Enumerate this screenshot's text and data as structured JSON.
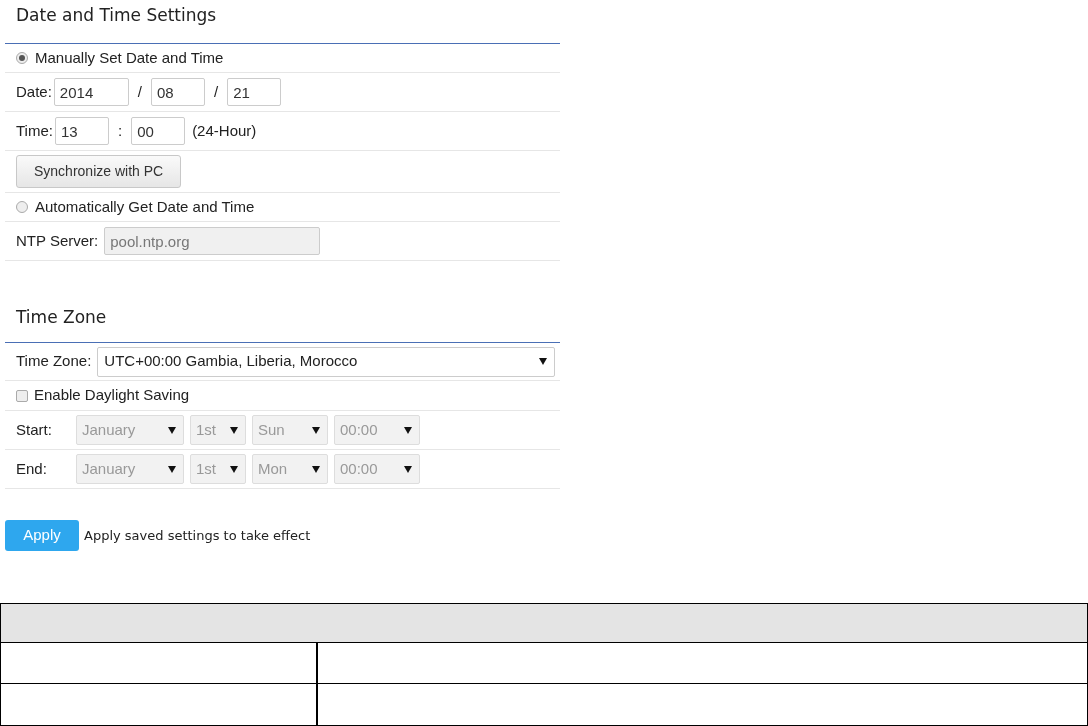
{
  "sections": [
    {
      "title": "Date and Time Settings",
      "rows": [
        {
          "kind": "radio",
          "label": "Manually Set Date and Time",
          "selected": true
        },
        {
          "kind": "fields",
          "label": "Date:",
          "items": [
            {
              "kind": "input",
              "value": "2014"
            },
            {
              "kind": "sep",
              "text": "/"
            },
            {
              "kind": "input",
              "value": "08"
            },
            {
              "kind": "sep",
              "text": "/"
            },
            {
              "kind": "input",
              "value": "21"
            }
          ]
        },
        {
          "kind": "fields",
          "label": "Time:",
          "items": [
            {
              "kind": "input",
              "value": "13"
            },
            {
              "kind": "sep",
              "text": ":"
            },
            {
              "kind": "input",
              "value": "00"
            },
            {
              "kind": "note",
              "text": "(24-Hour)"
            }
          ]
        },
        {
          "kind": "button",
          "label": "Synchronize with PC"
        },
        {
          "kind": "radio",
          "label": "Automatically Get Date and Time",
          "selected": false
        },
        {
          "kind": "field",
          "label": "NTP Server:",
          "value": "pool.ntp.org",
          "disabled": true
        }
      ]
    },
    {
      "title": "Time Zone",
      "rows": [
        {
          "kind": "select",
          "label": "Time Zone:",
          "value": "UTC+00:00 Gambia, Liberia, Morocco",
          "disabled": false
        },
        {
          "kind": "checkbox",
          "label": "Enable Daylight Saving",
          "checked": false
        },
        {
          "kind": "selects",
          "label": "Start:",
          "disabled": true,
          "options": [
            "January",
            "1st",
            "Sun",
            "00:00"
          ]
        },
        {
          "kind": "selects",
          "label": "End:",
          "disabled": true,
          "options": [
            "January",
            "1st",
            "Mon",
            "00:00"
          ]
        }
      ]
    }
  ],
  "apply": {
    "button": "Apply",
    "note": "Apply saved settings to take effect"
  }
}
